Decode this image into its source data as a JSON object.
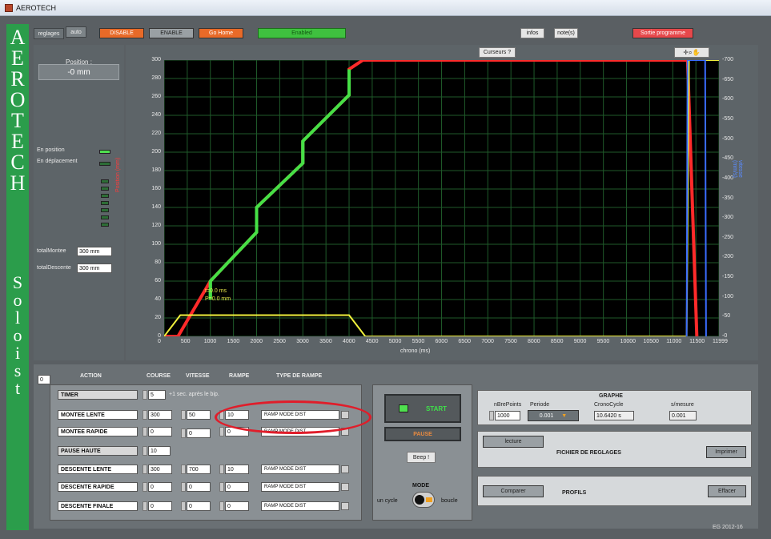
{
  "app": {
    "title": "AEROTECH",
    "footer": "EG 2012-16"
  },
  "sideband": {
    "letters_top": [
      "A",
      "E",
      "R",
      "O",
      "T",
      "E",
      "C",
      "H"
    ],
    "letters_bottom": [
      "S",
      "o",
      "l",
      "o",
      "i",
      "s",
      "t"
    ]
  },
  "toolbar": {
    "tab_reglages": "reglages",
    "tab_auto": "auto",
    "disable": "DISABLE",
    "enable": "ENABLE",
    "go_home": "Go Home",
    "status": "Enabled",
    "infos": "infos",
    "notes": "note(s)",
    "sortie": "Sortie programme"
  },
  "left": {
    "position_label": "Position :",
    "position_value": "-0 mm",
    "en_position": "En position",
    "en_deplacement": "En déplacement",
    "total_montee_label": "totalMontee",
    "total_montee_value": "300 mm",
    "total_descente_label": "totalDescente",
    "total_descente_value": "300 mm"
  },
  "chart_header": {
    "curseurs": "Curseurs ?"
  },
  "chart_data": {
    "type": "line",
    "xlabel": "chrono (ms)",
    "ylabel": "Position (mm)",
    "y2label": "vitesse (mm/s)",
    "xticks": [
      "0",
      "500",
      "1000",
      "1500",
      "2000",
      "2500",
      "3000",
      "3500",
      "4000",
      "4500",
      "5000",
      "5500",
      "6000",
      "6500",
      "7000",
      "7500",
      "8000",
      "8500",
      "9000",
      "9500",
      "10000",
      "10500",
      "11000",
      "11500",
      "11999"
    ],
    "yticks": [
      "0",
      "20",
      "40",
      "60",
      "80",
      "100",
      "120",
      "140",
      "160",
      "180",
      "200",
      "220",
      "240",
      "260",
      "280",
      "300"
    ],
    "y2ticks": [
      "0",
      "50",
      "100",
      "150",
      "200",
      "250",
      "300",
      "350",
      "400",
      "450",
      "500",
      "550",
      "600",
      "650",
      "700"
    ],
    "xlim": [
      0,
      11999
    ],
    "ylim": [
      0,
      300
    ],
    "y2lim": [
      0,
      700
    ],
    "cursor_label_1": "t=0.0 ms",
    "cursor_label_2": "P=0.0 mm",
    "series": [
      {
        "color": "#ff2a2a",
        "x": [
          0,
          300,
          1000,
          2000,
          2000,
          3000,
          3000,
          4000,
          4000,
          4300,
          11320,
          11520
        ],
        "y": [
          0,
          0,
          60,
          113,
          140,
          188,
          212,
          262,
          290,
          300,
          300,
          0
        ]
      },
      {
        "color": "#46e046",
        "x": [
          1000,
          1000,
          2000,
          2000,
          3000,
          3000,
          4000,
          4000
        ],
        "y": [
          40,
          60,
          113,
          140,
          188,
          212,
          262,
          290
        ]
      },
      {
        "color": "#f0f03c",
        "x": [
          0,
          350,
          4000,
          4350,
          11300,
          11350,
          11999
        ],
        "y": [
          0,
          23,
          23,
          0,
          0,
          300,
          300
        ]
      },
      {
        "color": "#3a6cff",
        "x": [
          11300,
          11320,
          11700,
          11720
        ],
        "y": [
          0,
          300,
          300,
          0
        ]
      }
    ]
  },
  "table": {
    "index": "0",
    "headers": {
      "action": "ACTION",
      "course": "COURSE",
      "vitesse": "VITESSE",
      "rampe": "RAMPE",
      "type_rampe": "TYPE DE RAMPE"
    },
    "rows": [
      {
        "action": "TIMER",
        "course": "5",
        "note": "+1 sec.  après le bip."
      },
      {
        "action": "MONTEE LENTE",
        "course": "300",
        "vitesse": "50",
        "rampe": "10",
        "type": "RAMP MODE DIST"
      },
      {
        "action": "MONTEE RAPIDE",
        "course": "0",
        "vitesse": "0",
        "rampe": "0",
        "type": "RAMP MODE DIST"
      },
      {
        "action": "PAUSE HAUTE",
        "course": "10"
      },
      {
        "action": "DESCENTE LENTE",
        "course": "300",
        "vitesse": "700",
        "rampe": "10",
        "type": "RAMP MODE DIST"
      },
      {
        "action": "DESCENTE RAPIDE",
        "course": "0",
        "vitesse": "0",
        "rampe": "0",
        "type": "RAMP MODE DIST"
      },
      {
        "action": "DESCENTE FINALE",
        "course": "0",
        "vitesse": "0",
        "rampe": "0",
        "type": "RAMP MODE DIST"
      }
    ]
  },
  "controls": {
    "start": "START",
    "pause": "PAUSE",
    "beep": "Beep !",
    "mode_label": "MODE",
    "un_cycle": "un cycle",
    "boucle": "boucle"
  },
  "graphe": {
    "title": "GRAPHE",
    "nbre_label": "nBrePoints",
    "nbre_value": "1000",
    "periode_label": "Periode",
    "periode_value": "0.001",
    "cronocycle_label": "CronoCycle",
    "cronocycle_value": "10.6420 s",
    "smesure_label": "s/mesure",
    "smesure_value": "0.001"
  },
  "reglages": {
    "lecture": "lecture",
    "title": "FICHIER DE REGLAGES",
    "imprimer": "Imprimer"
  },
  "profils": {
    "comparer": "Comparer",
    "title": "PROFILS",
    "effacer": "Effacer"
  }
}
